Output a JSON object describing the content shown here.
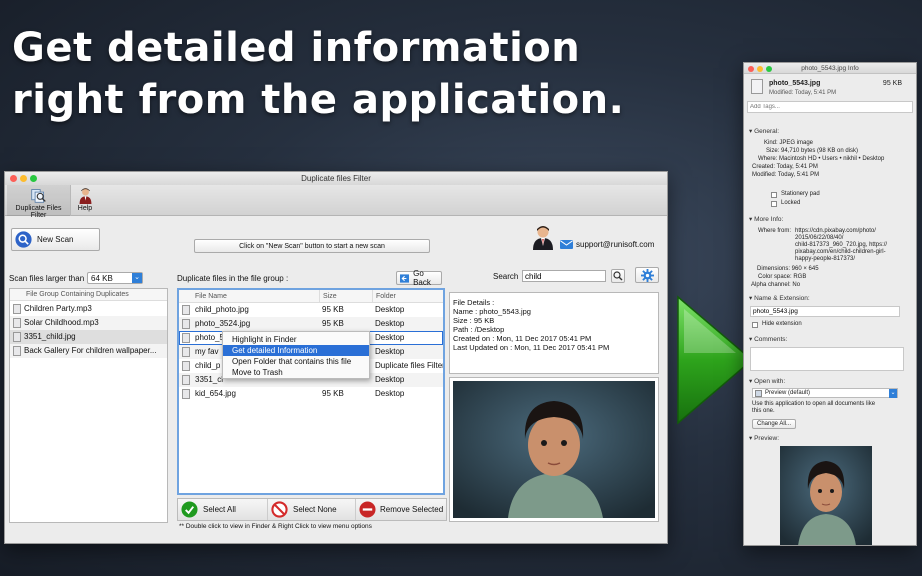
{
  "headline": {
    "line1": "Get detailed information",
    "line2": "right from the application."
  },
  "window": {
    "title": "Duplicate files Filter"
  },
  "toolbar": {
    "duplicate_label": "Duplicate Files Filter",
    "help_label": "Help"
  },
  "new_scan": {
    "label": "New Scan",
    "status_text": "Click on \"New Scan\" button to start a new scan"
  },
  "support": {
    "email": "support@runisoft.com"
  },
  "scan_size": {
    "label": "Scan files larger than",
    "value": "64 KB"
  },
  "left_list": {
    "header": "File Group Containing Duplicates",
    "items": [
      "Children Party.mp3",
      "Solar Childhood.mp3",
      "3351_child.jpg",
      "Back  Gallery For  children wallpaper..."
    ]
  },
  "group": {
    "label": "Duplicate files in the file group :",
    "go_back": "Go Back",
    "search_label": "Search",
    "search_value": "child",
    "columns": [
      "File Name",
      "Size",
      "Folder"
    ],
    "rows": [
      {
        "name": "child_photo.jpg",
        "size": "95 KB",
        "folder": "Desktop"
      },
      {
        "name": "photo_3524.jpg",
        "size": "95 KB",
        "folder": "Desktop"
      },
      {
        "name": "photo_5",
        "size": "",
        "folder": "Desktop"
      },
      {
        "name": "my fav",
        "size": "",
        "folder": "Desktop"
      },
      {
        "name": "child_p",
        "size": "",
        "folder": "Duplicate files Filter"
      },
      {
        "name": "3351_cl",
        "size": "",
        "folder": "Desktop"
      },
      {
        "name": "kid_654.jpg",
        "size": "95 KB",
        "folder": "Desktop"
      }
    ]
  },
  "context_menu": {
    "items": [
      "Highlight in Finder",
      "Get detailed Information",
      "Open Folder that contains this file",
      "Move to Trash"
    ]
  },
  "file_details": {
    "heading": "File Details :",
    "name": "Name : photo_5543.jpg",
    "size": "Size : 95 KB",
    "path": "Path : /Desktop",
    "created": "Created on : Mon, 11 Dec 2017 05:41 PM",
    "updated": "Last Updated on : Mon, 11 Dec 2017 05:41 PM"
  },
  "actions": {
    "select_all": "Select All",
    "select_none": "Select None",
    "remove_selected": "Remove Selected"
  },
  "hint": "** Double click to view in Finder & Right Click  to view menu options",
  "info_window": {
    "title": "photo_5543.jpg Info",
    "file_name": "photo_5543.jpg",
    "file_size": "95 KB",
    "modified": "Modified: Today, 5:41 PM",
    "tags_placeholder": "Add Tags...",
    "general_label": "General:",
    "kind": "Kind: JPEG image",
    "size": "Size: 94,710 bytes (98 KB on disk)",
    "where": "Where: Macintosh HD • Users • nikhil • Desktop",
    "created": "Created: Today, 5:41 PM",
    "modified_full": "Modified: Today, 5:41 PM",
    "stationery": "Stationery pad",
    "locked": "Locked",
    "more_info_label": "More Info:",
    "where_from_label": "Where from:",
    "where_from": [
      "https://cdn.pixabay.com/photo/",
      "2015/06/22/08/40/",
      "child-817373_960_720.jpg, https://",
      "pixabay.com/en/child-children-girl-",
      "happy-people-817373/"
    ],
    "dimensions": "Dimensions: 960 × 645",
    "color_space": "Color space: RGB",
    "alpha": "Alpha channel: No",
    "name_ext_label": "Name & Extension:",
    "name_value": "photo_5543.jpg",
    "hide_ext": "Hide extension",
    "comments_label": "Comments:",
    "open_with_label": "Open with:",
    "open_with_value": "Preview (default)",
    "open_with_note": [
      "Use this application to open all documents like",
      "this one."
    ],
    "change_all": "Change All...",
    "preview_label": "Preview:"
  },
  "colors": {
    "accent": "#2a6fd6",
    "arrow_green": "#2ea41c",
    "select_all_green": "#1f9a1f",
    "none_red": "#d42a2a"
  }
}
